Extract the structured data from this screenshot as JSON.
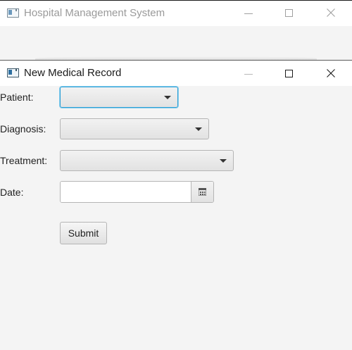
{
  "background_window": {
    "title": "Hospital Management System"
  },
  "dialog": {
    "title": "New Medical Record",
    "form": {
      "patient_label": "Patient:",
      "patient_value": "",
      "diagnosis_label": "Diagnosis:",
      "diagnosis_value": "",
      "treatment_label": "Treatment:",
      "treatment_value": "",
      "date_label": "Date:",
      "date_value": "",
      "submit_label": "Submit"
    }
  },
  "colors": {
    "focus_border": "#2a9fd6",
    "window_background": "#f4f4f4",
    "titlebar_background": "#ffffff"
  }
}
